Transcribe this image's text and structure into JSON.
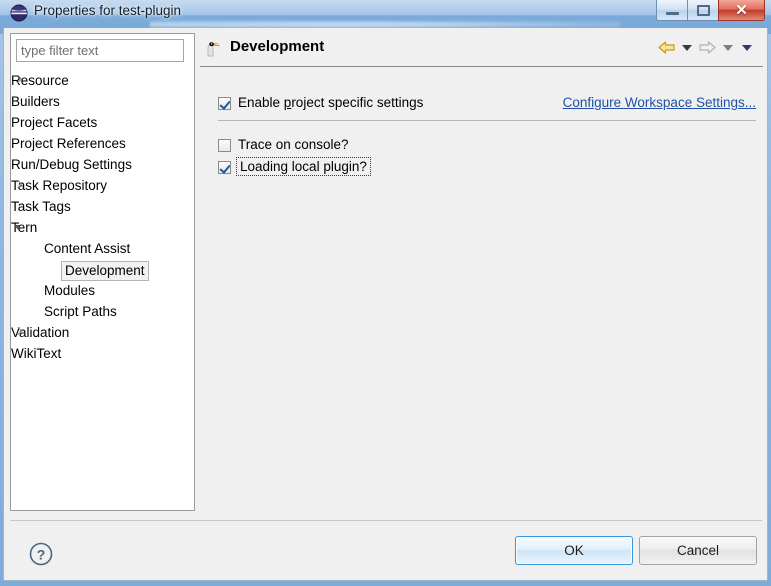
{
  "window": {
    "title": "Properties for test-plugin",
    "icon": "eclipse-icon",
    "controls": {
      "minimize": "minimize-button",
      "maximize": "maximize-button",
      "close_glyph": "✕"
    }
  },
  "tree": {
    "filter": {
      "value": "",
      "placeholder": "type filter text"
    },
    "items": [
      {
        "label": "Resource",
        "level": 0,
        "state": "collapsed",
        "selected": false
      },
      {
        "label": "Builders",
        "level": 0,
        "state": "leaf",
        "selected": false
      },
      {
        "label": "Project Facets",
        "level": 0,
        "state": "leaf",
        "selected": false
      },
      {
        "label": "Project References",
        "level": 0,
        "state": "leaf",
        "selected": false
      },
      {
        "label": "Run/Debug Settings",
        "level": 0,
        "state": "leaf",
        "selected": false
      },
      {
        "label": "Task Repository",
        "level": 0,
        "state": "collapsed",
        "selected": false
      },
      {
        "label": "Task Tags",
        "level": 0,
        "state": "leaf",
        "selected": false
      },
      {
        "label": "Tern",
        "level": 0,
        "state": "expanded",
        "selected": false
      },
      {
        "label": "Content Assist",
        "level": 1,
        "state": "leaf",
        "selected": false
      },
      {
        "label": "Development",
        "level": 1,
        "state": "leaf",
        "selected": true
      },
      {
        "label": "Modules",
        "level": 1,
        "state": "leaf",
        "selected": false
      },
      {
        "label": "Script Paths",
        "level": 1,
        "state": "leaf",
        "selected": false
      },
      {
        "label": "Validation",
        "level": 0,
        "state": "collapsed",
        "selected": false
      },
      {
        "label": "WikiText",
        "level": 0,
        "state": "leaf",
        "selected": false
      }
    ]
  },
  "page": {
    "title": "Development",
    "icon": "tern-bird-icon",
    "nav": {
      "back_icon": "back-arrow-icon",
      "back_menu_icon": "chevron-down-icon",
      "forward_icon": "forward-arrow-icon",
      "forward_menu_icon": "chevron-down-icon",
      "overflow_menu_icon": "chevron-down-icon"
    },
    "enable_row": {
      "checkbox_label": "Enable project specific settings",
      "checkbox_mnemonic": "p",
      "checked": true,
      "workspace_link": "Configure Workspace Settings..."
    },
    "options": [
      {
        "label": "Trace on console?",
        "checked": false,
        "focused": false
      },
      {
        "label": "Loading local plugin?",
        "checked": true,
        "focused": true
      }
    ]
  },
  "footer": {
    "help_icon": "question-mark-icon",
    "ok_label": "OK",
    "cancel_label": "Cancel"
  },
  "colors": {
    "titlebar_blue": "#8fb8e2",
    "close_red": "#c23a27",
    "link_blue": "#2151a6",
    "default_button_border": "#3c94d4",
    "dialog_gray": "#f0f0f0",
    "tern_accent_orange": "#f08a00"
  }
}
